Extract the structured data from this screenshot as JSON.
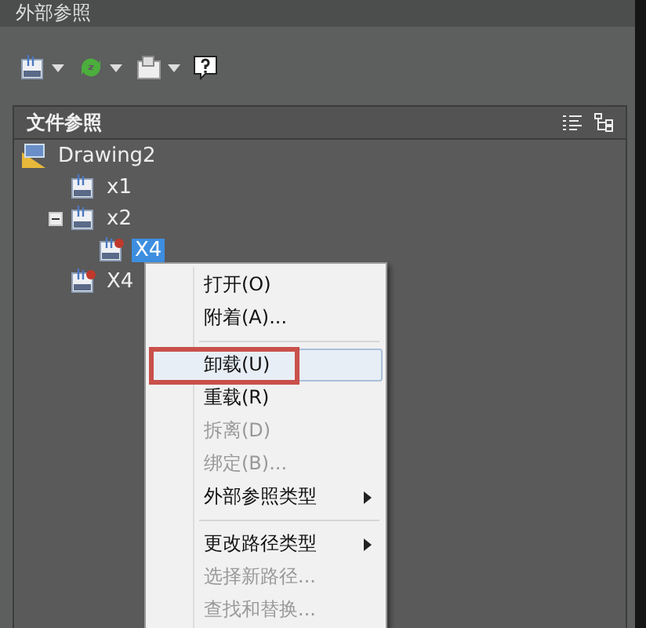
{
  "window": {
    "title": "外部参照"
  },
  "toolbar": [
    {
      "kind": "attach-dwg",
      "dropdown": true
    },
    {
      "kind": "refresh",
      "dropdown": true
    },
    {
      "kind": "change-path",
      "dropdown": true
    },
    {
      "kind": "help",
      "dropdown": false
    }
  ],
  "panel": {
    "title": "文件参照",
    "tree": [
      {
        "label": "Drawing2",
        "kind": "drawing",
        "selected": false,
        "children": [
          {
            "label": "x1",
            "kind": "xref",
            "missing": false,
            "selected": false
          },
          {
            "label": "x2",
            "kind": "xref",
            "missing": false,
            "selected": false,
            "expanded": true,
            "children": [
              {
                "label": "X4",
                "kind": "xref",
                "missing": true,
                "selected": true
              }
            ]
          },
          {
            "label": "X4",
            "kind": "xref",
            "missing": true,
            "selected": false
          }
        ]
      }
    ]
  },
  "context_menu": [
    {
      "kind": "item",
      "label": "打开(O)",
      "disabled": false,
      "selected": false,
      "submenu": false
    },
    {
      "kind": "item",
      "label": "附着(A)...",
      "disabled": false,
      "selected": false,
      "submenu": false
    },
    {
      "kind": "separator"
    },
    {
      "kind": "item",
      "label": "卸载(U)",
      "disabled": false,
      "selected": true,
      "submenu": false,
      "annotated": true
    },
    {
      "kind": "item",
      "label": "重载(R)",
      "disabled": false,
      "selected": false,
      "submenu": false
    },
    {
      "kind": "item",
      "label": "拆离(D)",
      "disabled": true,
      "selected": false,
      "submenu": false
    },
    {
      "kind": "item",
      "label": "绑定(B)...",
      "disabled": true,
      "selected": false,
      "submenu": false
    },
    {
      "kind": "item",
      "label": "外部参照类型",
      "disabled": false,
      "selected": false,
      "submenu": true
    },
    {
      "kind": "separator"
    },
    {
      "kind": "item",
      "label": "更改路径类型",
      "disabled": false,
      "selected": false,
      "submenu": true
    },
    {
      "kind": "item",
      "label": "选择新路径...",
      "disabled": true,
      "selected": false,
      "submenu": false
    },
    {
      "kind": "item",
      "label": "查找和替换...",
      "disabled": true,
      "selected": false,
      "submenu": false
    }
  ]
}
